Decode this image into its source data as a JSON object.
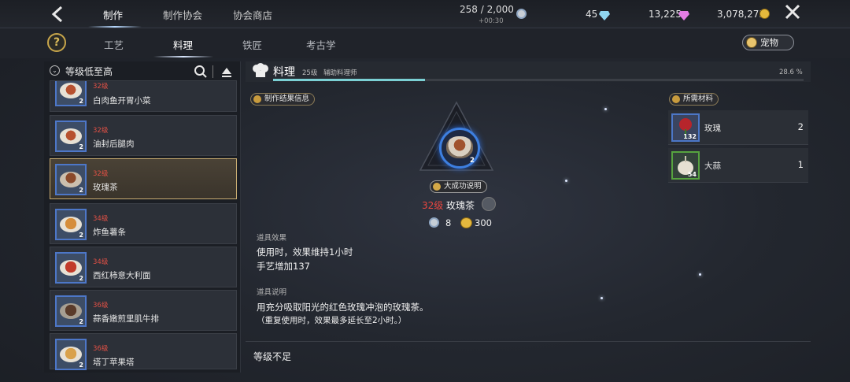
{
  "topbar": {
    "tabs": [
      {
        "label": "制作",
        "active": true
      },
      {
        "label": "制作协会",
        "active": false
      },
      {
        "label": "协会商店",
        "active": false
      }
    ],
    "stamina": "258 / 2,000",
    "stamina_timer": "+00:30",
    "gems": "45",
    "premium": "13,225",
    "gold": "3,078,273",
    "icons": {
      "back": "back-arrow-icon",
      "close": "close-icon",
      "gem": "diamond-icon",
      "premium": "pink-gem-icon",
      "gold": "gold-coin-icon"
    }
  },
  "subtabs": {
    "help": "?",
    "items": [
      {
        "label": "工艺",
        "active": false
      },
      {
        "label": "料理",
        "active": true
      },
      {
        "label": "铁匠",
        "active": false
      },
      {
        "label": "考古学",
        "active": false
      }
    ],
    "pet_label": "宠物"
  },
  "sidebar": {
    "sort_label": "等级低至高",
    "items": [
      {
        "level": "32级",
        "name": "白肉鱼开胃小菜",
        "count": "2",
        "selected": false
      },
      {
        "level": "32级",
        "name": "油封后腿肉",
        "count": "2",
        "selected": false
      },
      {
        "level": "32级",
        "name": "玫瑰茶",
        "count": "2",
        "selected": true
      },
      {
        "level": "34级",
        "name": "炸鱼薯条",
        "count": "2",
        "selected": false
      },
      {
        "level": "34级",
        "name": "西红柿意大利面",
        "count": "2",
        "selected": false
      },
      {
        "level": "36级",
        "name": "蒜香嫩煎里肌牛排",
        "count": "2",
        "selected": false
      },
      {
        "level": "36级",
        "name": "塔丁苹果塔",
        "count": "2",
        "selected": false
      }
    ]
  },
  "main": {
    "title": "料理",
    "level": "25级",
    "role": "辅助料理师",
    "progress_percent": 28.6,
    "progress_text": "28.6 %",
    "result_info_label": "制作结果信息",
    "great_success_label": "大成功说明",
    "result": {
      "level": "32级",
      "name": "玫瑰茶",
      "count": "2"
    },
    "cost": {
      "item": "8",
      "gold": "300"
    },
    "effect_label": "道具效果",
    "effect_line1": "使用时，效果维持1小时",
    "effect_line2": "手艺增加137",
    "desc_label": "道具说明",
    "desc_line1": "用充分吸取阳光的红色玫瑰冲泡的玫瑰茶。",
    "desc_line2": "（重复使用时，效果最多延长至2小时。）",
    "status": "等级不足"
  },
  "materials": {
    "label": "所需材料",
    "items": [
      {
        "name": "玫瑰",
        "owned": "132",
        "required": "2"
      },
      {
        "name": "大蒜",
        "owned": "54",
        "required": "1"
      }
    ]
  }
}
